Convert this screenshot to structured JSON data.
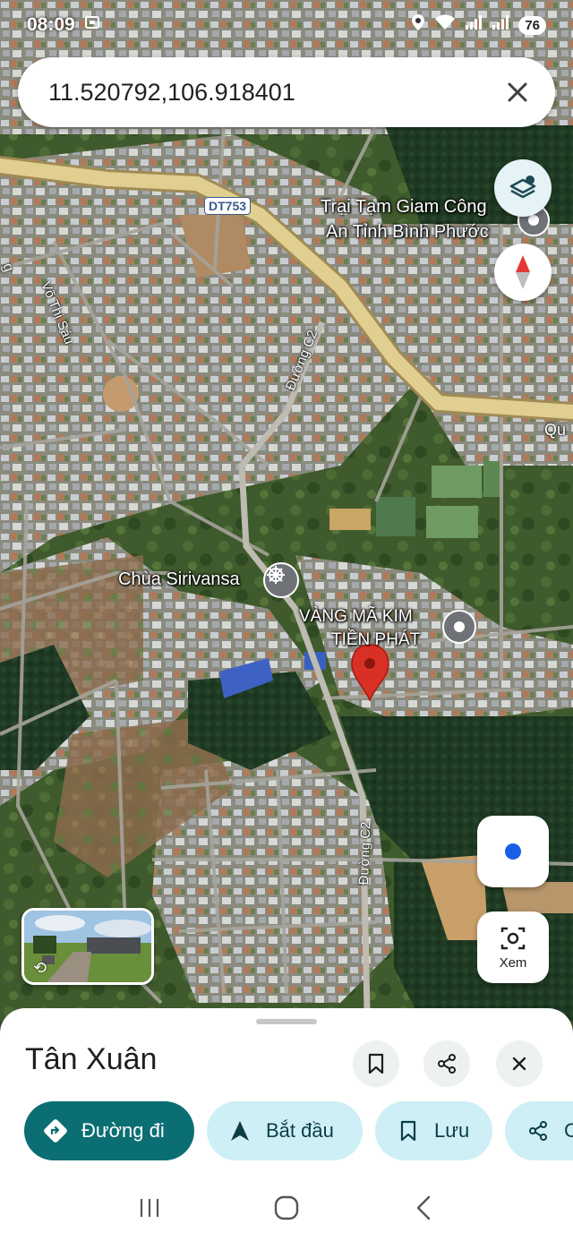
{
  "status_bar": {
    "time": "08:09",
    "battery": "76"
  },
  "search": {
    "query": "11.520792,106.918401"
  },
  "map": {
    "places": {
      "detention_center": "Trại Tạm Giam Công An Tỉnh Bình Phước",
      "detention_center_line1": "Trại Tạm Giam Công",
      "detention_center_line2": "An Tỉnh Bình Phước",
      "pagoda": "Chùa Sirivansa",
      "gold_shop_line1": "VÀNG MÃ KIM",
      "gold_shop_line2": "TIỀN PHÁT"
    },
    "roads": {
      "dt753": "DT753",
      "vo_thi_sau": "Võ Thị Sáu",
      "duong_c2_north": "Đường C2",
      "duong_c2_south": "Đường C2",
      "edge_qu": "Qu",
      "edge_left": "g"
    },
    "icons": {
      "pin": "red-location-pin",
      "pagoda": "dharma-wheel-icon",
      "place_marker": "grey-place-marker"
    }
  },
  "controls": {
    "layers": "layers-icon",
    "compass": "compass-icon",
    "my_location": "my-location-icon",
    "lens_label": "Xem"
  },
  "sheet": {
    "title": "Tân Xuân",
    "chips": {
      "directions": "Đường đi",
      "start": "Bắt đầu",
      "save": "Lưu",
      "share": "C"
    }
  },
  "colors": {
    "accent_primary": "#0b6e73",
    "chip_secondary": "#cdeff5",
    "pin_red": "#d93025",
    "location_blue": "#1a5ee8"
  }
}
